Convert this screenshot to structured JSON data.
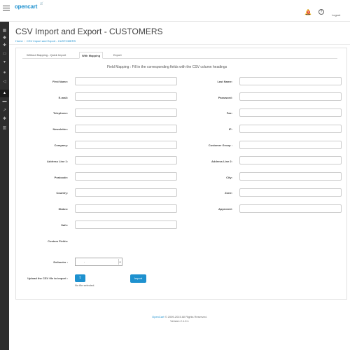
{
  "header": {
    "logo": "opencart",
    "notification_count": "9",
    "logout_label": "Logout"
  },
  "page": {
    "title": "CSV Import and Export - CUSTOMERS",
    "breadcrumb": [
      "Home",
      "CSV Import and Export - CUSTOMERS"
    ]
  },
  "tabs": [
    {
      "label": "Without Mapping - Quick Import"
    },
    {
      "label": "With Mapping"
    },
    {
      "label": "Export"
    }
  ],
  "mapping_hint": "Field Mapping : Fill in the corresponding fields with the CSV column headings",
  "fields_left": [
    {
      "label": "First Name:",
      "value": ""
    },
    {
      "label": "E-mail:",
      "value": ""
    },
    {
      "label": "Telephone:",
      "value": ""
    },
    {
      "label": "Newsletter:",
      "value": ""
    },
    {
      "label": "Company:",
      "value": ""
    },
    {
      "label": "Address Line 1:",
      "value": ""
    },
    {
      "label": "Postcode:",
      "value": ""
    },
    {
      "label": "Country:",
      "value": ""
    },
    {
      "label": "Status:",
      "value": ""
    },
    {
      "label": "Safe:",
      "value": ""
    }
  ],
  "fields_right": [
    {
      "label": "Last Name:",
      "value": ""
    },
    {
      "label": "Password:",
      "value": ""
    },
    {
      "label": "Fax:",
      "value": ""
    },
    {
      "label": "IP:",
      "value": ""
    },
    {
      "label": "Customer Group :",
      "value": ""
    },
    {
      "label": "Address Line 2:",
      "value": ""
    },
    {
      "label": "City:",
      "value": ""
    },
    {
      "label": "Zone:",
      "value": ""
    },
    {
      "label": "Approved:",
      "value": ""
    }
  ],
  "custom_fields_label": "Custom Fields:",
  "delimeter": {
    "label": "Delimeter :",
    "value": ","
  },
  "upload": {
    "label": "Upload the CSV file to import :",
    "no_file_text": "No file selected.",
    "import_label": "Import"
  },
  "footer": {
    "brand": "OpenCart",
    "copyright": " © 2009-2015 All Rights Reserved.",
    "version": "Version 2.1.0.1"
  },
  "colors": {
    "accent": "#1e91cf",
    "sidebar": "#2e2e2e"
  }
}
